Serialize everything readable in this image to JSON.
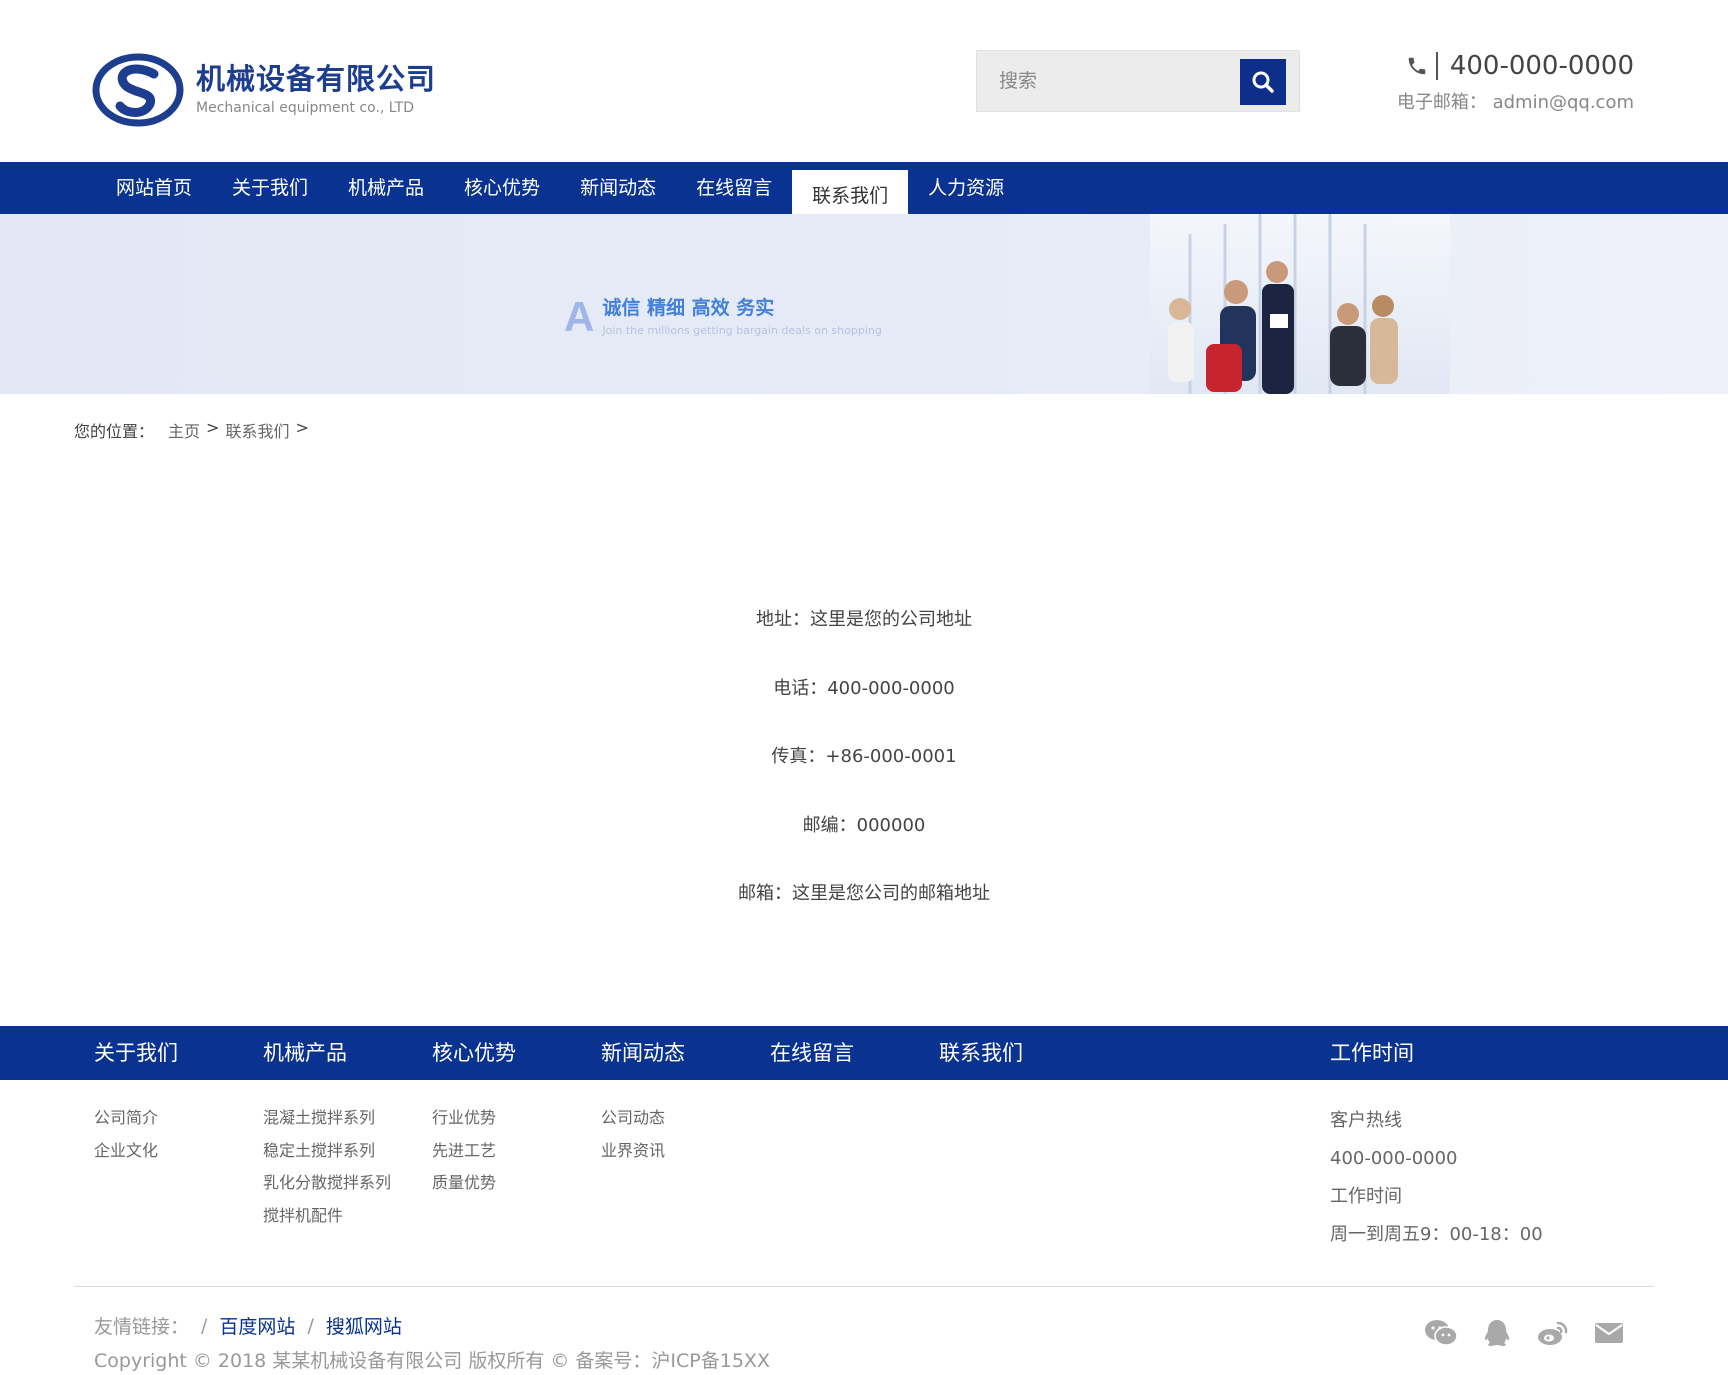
{
  "header": {
    "logo_cn": "机械设备有限公司",
    "logo_en": "Mechanical equipment co., LTD",
    "search_placeholder": "搜索",
    "phone": "400-000-0000",
    "email": "电子邮箱：  admin@qq.com"
  },
  "nav": {
    "items": [
      "网站首页",
      "关于我们",
      "机械产品",
      "核心优势",
      "新闻动态",
      "在线留言",
      "联系我们",
      "人力资源"
    ],
    "active": "联系我们"
  },
  "banner": {
    "letter": "A",
    "slogan": "诚信 精细 高效 务实",
    "subtext": "Join the millions getting bargain deals on shopping"
  },
  "breadcrumb": {
    "label": "您的位置：",
    "home": "主页",
    "current": "联系我们",
    "separator": ">"
  },
  "contact_info": {
    "address": "地址：这里是您的公司地址",
    "phone": "电话：400-000-0000",
    "fax": "传真：+86-000-0001",
    "zip": "邮编：000000",
    "email": "邮箱：这里是您公司的邮箱地址"
  },
  "footer": {
    "nav": [
      "关于我们",
      "机械产品",
      "核心优势",
      "新闻动态",
      "在线留言",
      "联系我们",
      "工作时间"
    ],
    "col_about": [
      "公司简介",
      "企业文化"
    ],
    "col_products": [
      "混凝土搅拌系列",
      "稳定土搅拌系列",
      "乳化分散搅拌系列",
      "搅拌机配件"
    ],
    "col_advantage": [
      "行业优势",
      "先进工艺",
      "质量优势"
    ],
    "col_news": [
      "公司动态",
      "业界资讯"
    ],
    "work": {
      "hotline_label": "客户热线",
      "hotline": "400-000-0000",
      "time_label": "工作时间",
      "time": "周一到周五9：00-18：00"
    },
    "friends_label": "友情链接：",
    "friends": [
      "百度网站",
      "搜狐网站"
    ],
    "copyright": "Copyright © 2018 某某机械设备有限公司 版权所有 © 备案号：沪ICP备15XX"
  },
  "colors": {
    "brand_blue": "#0a3290",
    "logo_blue": "#1d3d8f",
    "banner_text": "#4580d8"
  },
  "icons": [
    "phone-icon",
    "search-icon",
    "wechat-icon",
    "qq-icon",
    "weibo-icon",
    "mail-icon"
  ]
}
